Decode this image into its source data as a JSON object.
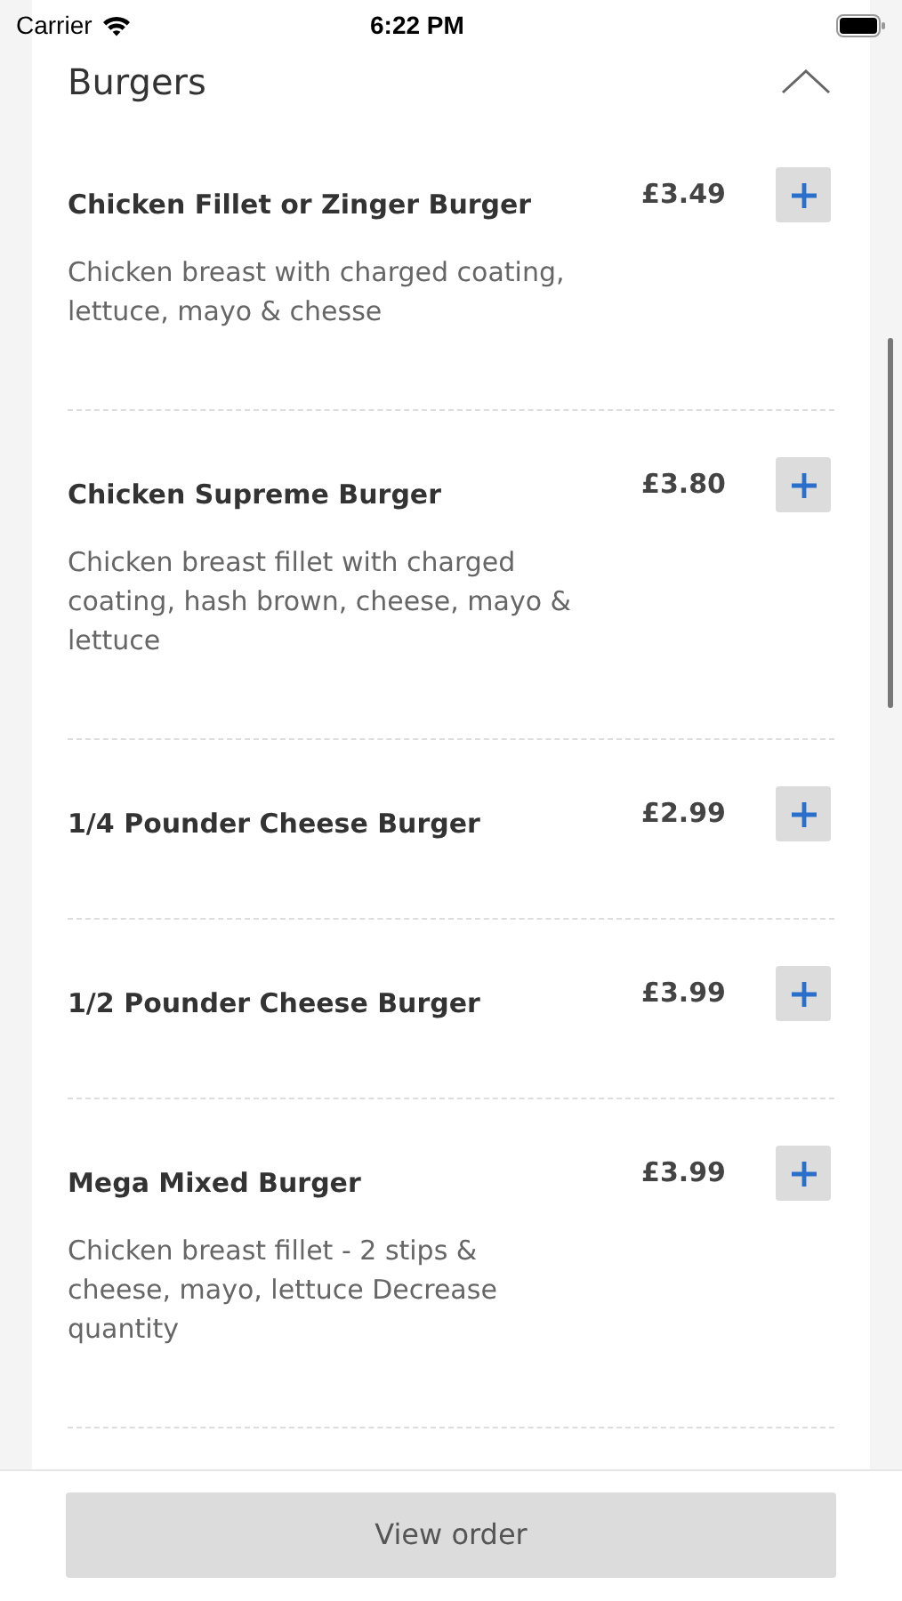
{
  "status_bar": {
    "carrier": "Carrier",
    "time": "6:22 PM"
  },
  "section": {
    "title": "Burgers",
    "expanded": true
  },
  "items": [
    {
      "name": "Chicken Fillet or Zinger Burger",
      "price": "£3.49",
      "description": "Chicken breast with charged coating, lettuce, mayo & chesse"
    },
    {
      "name": "Chicken Supreme Burger",
      "price": "£3.80",
      "description": "Chicken breast fillet with charged coating, hash brown, cheese, mayo & lettuce"
    },
    {
      "name": "1/4 Pounder Cheese Burger",
      "price": "£2.99"
    },
    {
      "name": "1/2 Pounder Cheese Burger",
      "price": "£3.99"
    },
    {
      "name": "Mega Mixed Burger",
      "price": "£3.99",
      "description": "Chicken breast fillet - 2 stips & cheese, mayo, lettuce Decrease quantity"
    }
  ],
  "footer": {
    "button": "View order"
  }
}
